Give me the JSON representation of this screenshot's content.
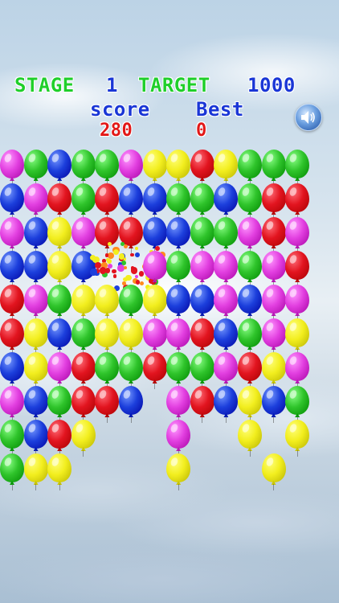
{
  "hud": {
    "stage_label": "STAGE",
    "stage_value": "1",
    "target_label": "TARGET",
    "target_value": "1000",
    "score_label": "score",
    "best_label": "Best",
    "score_value": "280",
    "best_value": "0"
  },
  "sound_button": {
    "icon": "speaker-icon"
  },
  "colors": {
    "magenta": "#e23fe0",
    "green": "#2fc42b",
    "blue": "#1c3fdc",
    "red": "#e2141f",
    "yellow": "#f2ee1e"
  },
  "grid": {
    "rows": [
      [
        "magenta",
        "green",
        "blue",
        "green",
        "green",
        "magenta",
        "yellow",
        "yellow",
        "red",
        "yellow",
        "green",
        "green",
        "green"
      ],
      [
        "blue",
        "magenta",
        "red",
        "green",
        "red",
        "blue",
        "blue",
        "green",
        "green",
        "blue",
        "green",
        "red",
        "red"
      ],
      [
        "magenta",
        "blue",
        "yellow",
        "magenta",
        "red",
        "red",
        "blue",
        "blue",
        "green",
        "green",
        "magenta",
        "red",
        "magenta"
      ],
      [
        "blue",
        "blue",
        "yellow",
        "blue",
        "burst",
        "burst",
        "magenta",
        "green",
        "magenta",
        "magenta",
        "green",
        "magenta",
        "red"
      ],
      [
        "red",
        "magenta",
        "green",
        "yellow",
        "yellow",
        "green",
        "yellow",
        "blue",
        "blue",
        "magenta",
        "blue",
        "magenta",
        "magenta"
      ],
      [
        "red",
        "yellow",
        "blue",
        "green",
        "yellow",
        "yellow",
        "magenta",
        "magenta",
        "red",
        "blue",
        "green",
        "magenta",
        "yellow"
      ],
      [
        "blue",
        "yellow",
        "magenta",
        "red",
        "green",
        "green",
        "red",
        "green",
        "green",
        "magenta",
        "red",
        "yellow",
        "magenta"
      ],
      [
        "magenta",
        "blue",
        "green",
        "red",
        "red",
        "blue",
        null,
        "magenta",
        "red",
        "blue",
        "yellow",
        "blue",
        "green"
      ],
      [
        "green",
        "blue",
        "red",
        "yellow",
        null,
        null,
        null,
        "magenta",
        null,
        null,
        "yellow",
        null,
        "yellow"
      ],
      [
        "green",
        "yellow",
        "yellow",
        null,
        null,
        null,
        null,
        "yellow",
        null,
        null,
        null,
        "yellow",
        null
      ]
    ]
  }
}
